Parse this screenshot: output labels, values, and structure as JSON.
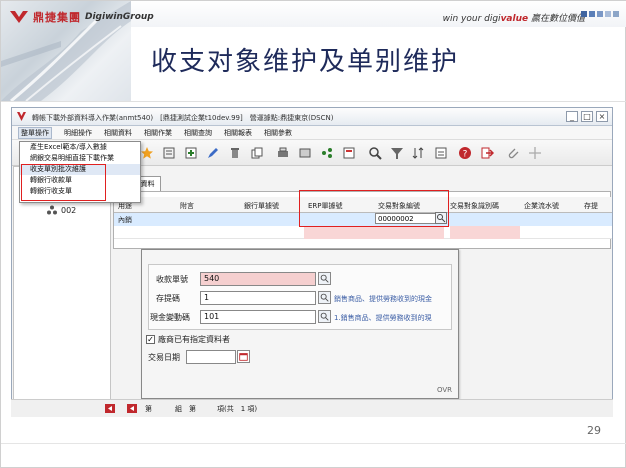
{
  "header": {
    "brand_cn": "鼎捷集團",
    "brand_en": "DigiwinGroup",
    "tagline_prefix": "win your digi",
    "tagline_accent": "value",
    "tagline_suffix": "贏在數位價值",
    "slide_title": "收支对象维护及单别维护",
    "page_number": "29"
  },
  "window": {
    "title": "轉帳下載外部資料導入作業(anmt540)　[鼎捷測試企業t10dev.99]　營運據點:鼎捷東京(DSCN)",
    "controls": [
      "_",
      "□",
      "×"
    ]
  },
  "menubar": [
    "整單操作",
    "明細操作",
    "相關資料",
    "相關作業",
    "相關查詢",
    "相關報表",
    "相關參數"
  ],
  "dropdown": [
    "產生Excel範本/導入數據",
    "網銀交易明細直接下載作業",
    "收支單別批次維護",
    "轉銀行收款單",
    "轉銀行收支單"
  ],
  "tree": {
    "node_label": "002"
  },
  "tab": "對帳單資料",
  "grid": {
    "headers": [
      "用途",
      "附言",
      "銀行單據號",
      "ERP單據號",
      "交易對象編號",
      "交易對象識別碼",
      "企業流水號",
      "存提"
    ],
    "row": {
      "usage": "內銷",
      "partner_no": "00000002"
    }
  },
  "form": {
    "receipt_type_label": "收款單號",
    "receipt_type_value": "540",
    "deposit_code_label": "存提碼",
    "deposit_code_value": "1",
    "deposit_code_hint": "銷售商品、提供勞務收到的現金",
    "cash_change_label": "現金變動碼",
    "cash_change_value": "101",
    "cash_change_hint": "1.銷售商品、提供勞務收到的現",
    "checkbox_label": "廠商已有指定資料者",
    "trade_date_label": "交易日期",
    "trade_date_value": "",
    "ovr": "OVR"
  },
  "status": {
    "seg1": "第",
    "seg2": "組　第",
    "seg3": "項(共　1 項)"
  }
}
